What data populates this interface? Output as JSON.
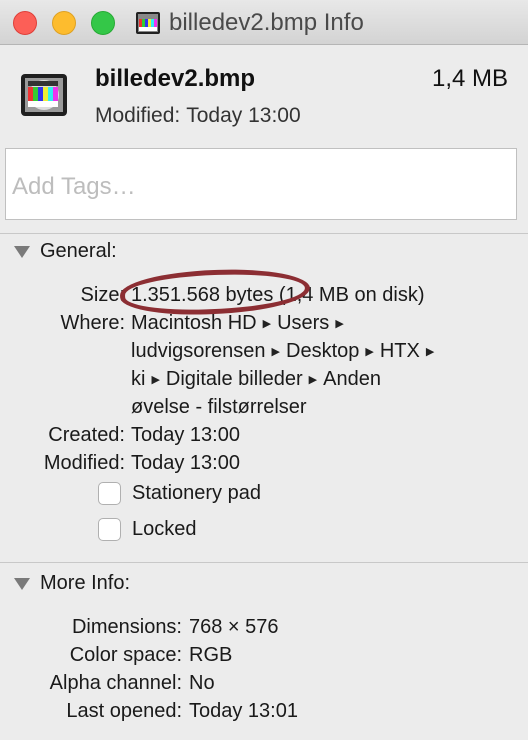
{
  "window": {
    "title": "billedev2.bmp Info"
  },
  "header": {
    "file_name": "billedev2.bmp",
    "size": "1,4 MB",
    "modified_label": "Modified:",
    "modified_value": "Today 13:00"
  },
  "tags": {
    "placeholder": "Add Tags…"
  },
  "general": {
    "title": "General:",
    "size_label": "Size:",
    "size_bytes": "1.351.568 bytes",
    "size_disk": "(1,4 MB on disk)",
    "where_label": "Where:",
    "where_path": [
      "Macintosh HD",
      "Users",
      "ludvigsorensen",
      "Desktop",
      "HTX",
      "ki",
      "Digitale billeder",
      "Anden øvelse - filstørrelser"
    ],
    "created_label": "Created:",
    "created_value": "Today 13:00",
    "modified_label": "Modified:",
    "modified_value": "Today 13:00",
    "stationery_label": "Stationery pad",
    "locked_label": "Locked"
  },
  "more_info": {
    "title": "More Info:",
    "dimensions_label": "Dimensions:",
    "dimensions_value": "768 × 576",
    "color_space_label": "Color space:",
    "color_space_value": "RGB",
    "alpha_label": "Alpha channel:",
    "alpha_value": "No",
    "last_opened_label": "Last opened:",
    "last_opened_value": "Today 13:01"
  },
  "colors": {
    "annotation": "#8c2e33",
    "close": "#fc5f57",
    "minimize": "#fdbc2e",
    "maximize": "#34c748"
  },
  "icons": [
    "close-icon",
    "minimize-icon",
    "maximize-icon",
    "bmp-file-icon",
    "disclosure-triangle-icon",
    "path-arrow-icon",
    "checkbox-icon"
  ]
}
